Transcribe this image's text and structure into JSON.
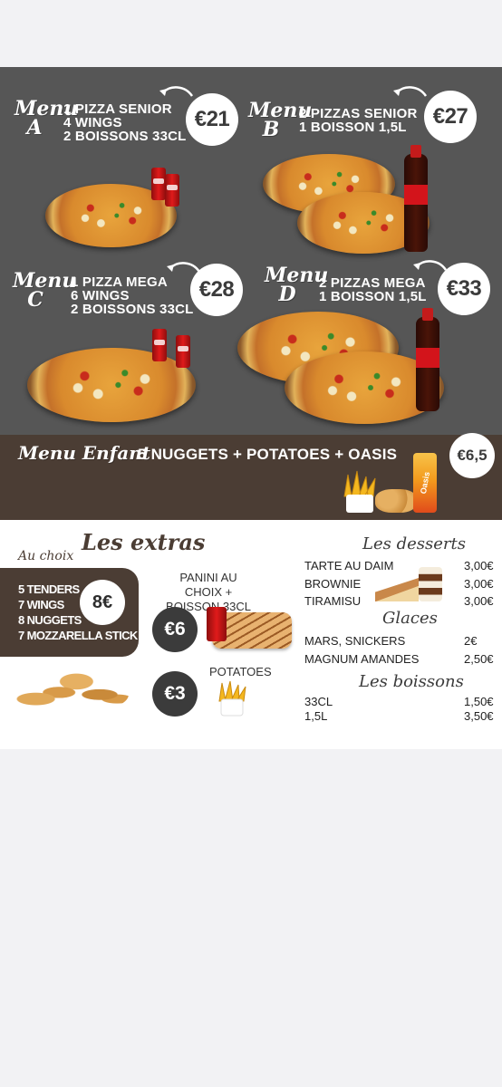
{
  "menus": [
    {
      "label_top": "Menu",
      "label_bottom": "A",
      "items": [
        "1 PIZZA SENIOR",
        "4 WINGS",
        "2 BOISSONS 33CL"
      ],
      "price": "€21"
    },
    {
      "label_top": "Menu",
      "label_bottom": "B",
      "items": [
        "2 PIZZAS SENIOR",
        "1 BOISSON 1,5L"
      ],
      "price": "€27"
    },
    {
      "label_top": "Menu",
      "label_bottom": "C",
      "items": [
        "1 PIZZA MEGA",
        "6 WINGS",
        "2 BOISSONS 33CL"
      ],
      "price": "€28"
    },
    {
      "label_top": "Menu",
      "label_bottom": "D",
      "items": [
        "2 PIZZAS MEGA",
        "1 BOISSON 1,5L"
      ],
      "price": "€33"
    }
  ],
  "enfant": {
    "title": "Menu Enfant",
    "items": "5 NUGGETS + POTATOES + OASIS",
    "price": "€6,5"
  },
  "extras": {
    "title": "Les extras",
    "au_choix": "Au choix",
    "tenders": [
      "5 TENDERS",
      "7 WINGS",
      "8 NUGGETS",
      "7 MOZZARELLA STICK"
    ],
    "tenders_price": "8€",
    "panini_label": "PANINI AU CHOIX + BOISSON 33CL",
    "panini_price": "€6",
    "potatoes_label": "POTATOES",
    "potatoes_price": "€3"
  },
  "desserts": {
    "title": "Les desserts",
    "rows": [
      {
        "name": "TARTE AU DAIM",
        "price": "3,00€"
      },
      {
        "name": "BROWNIE",
        "price": "3,00€"
      },
      {
        "name": "TIRAMISU",
        "price": "3,00€"
      }
    ]
  },
  "glaces": {
    "title": "Glaces",
    "rows": [
      {
        "name": "MARS, SNICKERS",
        "price": "2€"
      },
      {
        "name": "MAGNUM AMANDES",
        "price": "2,50€"
      }
    ]
  },
  "boissons": {
    "title": "Les boissons",
    "rows": [
      {
        "name": "33CL",
        "price": "1,50€"
      },
      {
        "name": "1,5L",
        "price": "3,50€"
      }
    ]
  },
  "colors": {
    "grey_panel": "#565656",
    "brown_panel": "#4b3d34",
    "background": "#f2f2f4"
  }
}
